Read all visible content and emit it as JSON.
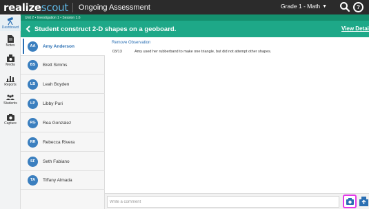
{
  "app": {
    "brand_realize": "realize",
    "brand_scout": "scout",
    "title": "Ongoing Assessment",
    "grade_select": "Grade 1 - Math",
    "help_glyph": "?"
  },
  "rail": [
    {
      "label": "Dashboard",
      "icon": "telescope-icon",
      "active": true
    },
    {
      "label": "Notes",
      "icon": "notes-icon"
    },
    {
      "label": "Media",
      "icon": "media-icon"
    },
    {
      "label": "Reports",
      "icon": "reports-icon"
    },
    {
      "label": "Students",
      "icon": "students-icon"
    },
    {
      "label": "Capture",
      "icon": "camera-icon"
    }
  ],
  "breadcrumb": "Unit 2 • Investigation 1 • Session 1.6",
  "header": {
    "title": "Student construct 2-D shapes on a geoboard.",
    "view_details": "View Details"
  },
  "students": [
    {
      "initials": "AA",
      "name": "Amy Anderson",
      "selected": true
    },
    {
      "initials": "BS",
      "name": "Brett Simms"
    },
    {
      "initials": "LB",
      "name": "Leah Boyden"
    },
    {
      "initials": "LP",
      "name": "Libby Puri"
    },
    {
      "initials": "RG",
      "name": "Rea Gonzalez"
    },
    {
      "initials": "RR",
      "name": "Rebecca Rivera"
    },
    {
      "initials": "SF",
      "name": "Seth Fabiano"
    },
    {
      "initials": "TA",
      "name": "Tiffany Almada"
    }
  ],
  "observation": {
    "remove_label": "Remove Observation",
    "date": "03/13",
    "text": "Amy used her rubberband to make one triangle, but did not attempt other shapes."
  },
  "comment": {
    "placeholder": "Write a comment",
    "value": ""
  },
  "colors": {
    "topbar": "#2b2b2b",
    "header_green": "#1ea888",
    "breadcrumb_green": "#14906e",
    "accent_blue": "#2a6fb3",
    "highlight_magenta": "#e33be8"
  }
}
